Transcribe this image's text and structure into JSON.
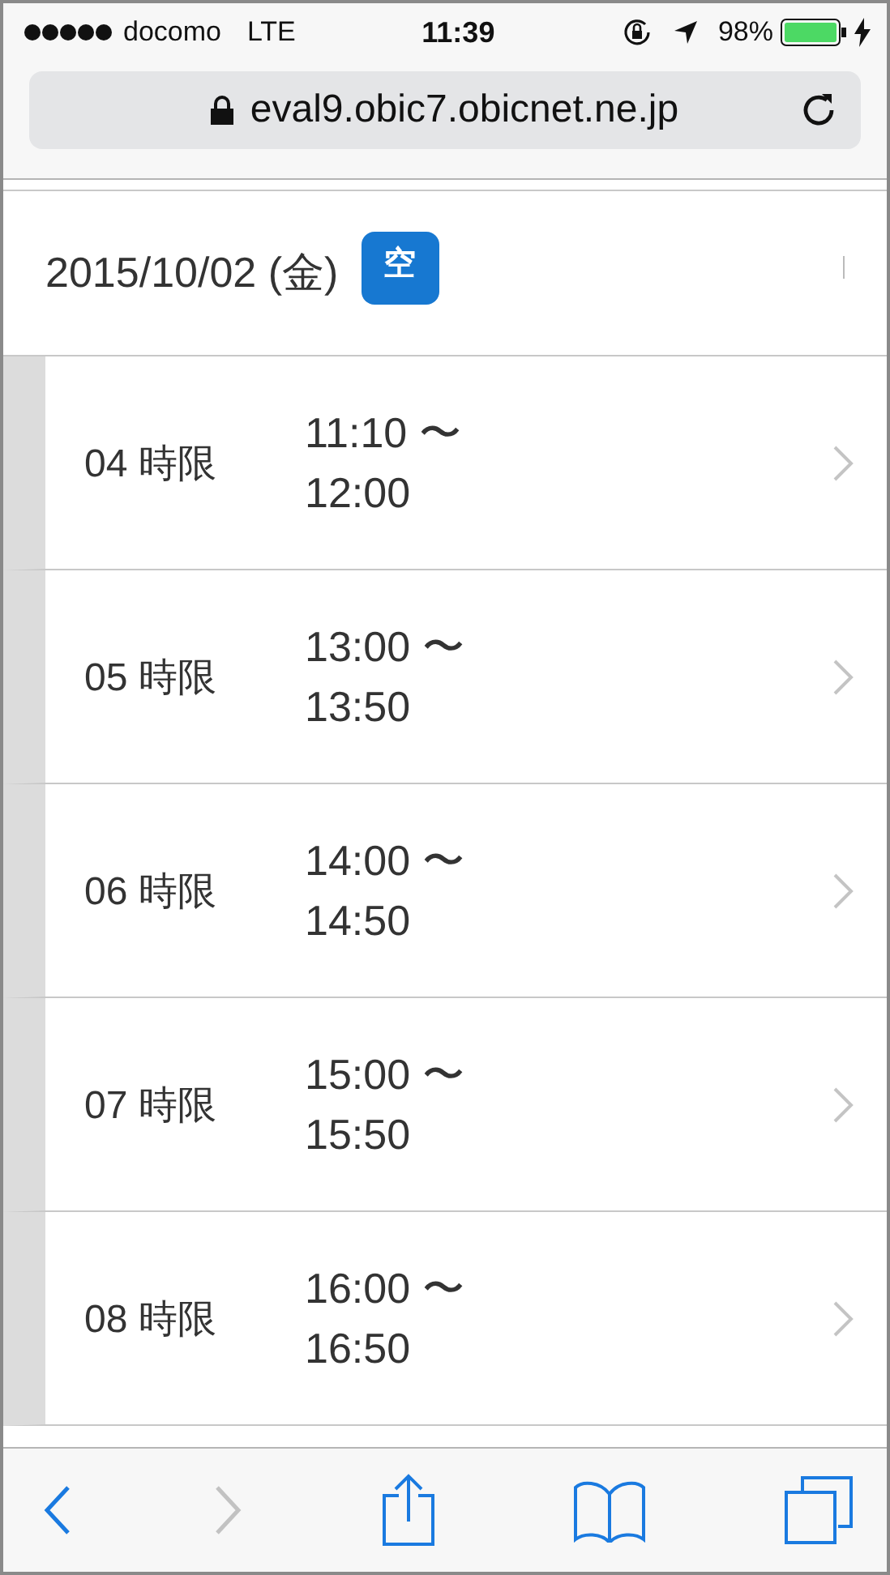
{
  "status_bar": {
    "carrier": "docomo",
    "network": "LTE",
    "time": "11:39",
    "battery": "98%",
    "charging": true
  },
  "address_bar": {
    "url": "eval9.obic7.obicnet.ne.jp",
    "secure": true
  },
  "date_header": {
    "date": "2015/10/02 (金)",
    "badge": "空"
  },
  "periods": [
    {
      "label": "04 時限",
      "start": "11:10 〜",
      "end": "12:00"
    },
    {
      "label": "05 時限",
      "start": "13:00 〜",
      "end": "13:50"
    },
    {
      "label": "06 時限",
      "start": "14:00 〜",
      "end": "14:50"
    },
    {
      "label": "07 時限",
      "start": "15:00 〜",
      "end": "15:50"
    },
    {
      "label": "08 時限",
      "start": "16:00 〜",
      "end": "16:50"
    }
  ],
  "toolbar": [
    {
      "kind": "back",
      "disabled": false
    },
    {
      "kind": "forward",
      "disabled": true
    },
    {
      "kind": "share",
      "disabled": false
    },
    {
      "kind": "bookmarks",
      "disabled": false
    },
    {
      "kind": "tabs",
      "disabled": false
    }
  ]
}
